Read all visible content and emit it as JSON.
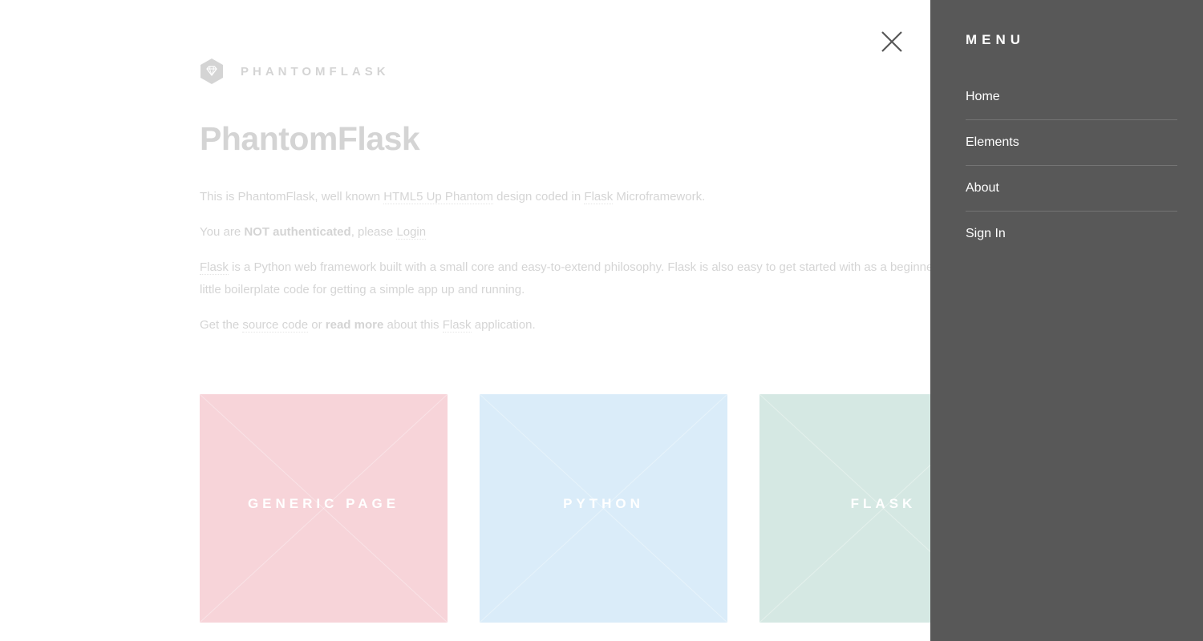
{
  "site": {
    "logo_title": "PHANTOMFLASK",
    "page_title": "PhantomFlask"
  },
  "intro": {
    "p1": {
      "t1": "This is PhantomFlask, well known ",
      "link1": "HTML5 Up Phantom",
      "t2": " design coded in ",
      "link2": "Flask",
      "t3": " Microframework."
    },
    "p2": {
      "t1": "You are ",
      "strong": "NOT authenticated",
      "t2": ", please ",
      "link": "Login"
    },
    "p3": {
      "link": "Flask",
      "t1": " is a Python web framework built with a small core and easy-to-extend philosophy. Flask is also easy to get started with as a beginner beca",
      "line2": "little boilerplate code for getting a simple app up and running."
    },
    "p4": {
      "t1": "Get the ",
      "link1": "source code",
      "t2": " or ",
      "strong": "read more",
      "t3": " about this ",
      "link2": "Flask",
      "t4": " application."
    }
  },
  "tiles": [
    {
      "label": "GENERIC PAGE",
      "color": "#e0566c"
    },
    {
      "label": "PYTHON",
      "color": "#6fb8e8"
    },
    {
      "label": "FLASK",
      "color": "#5ca891"
    }
  ],
  "menu": {
    "heading": "MENU",
    "items": [
      {
        "label": "Home"
      },
      {
        "label": "Elements"
      },
      {
        "label": "About"
      },
      {
        "label": "Sign In"
      }
    ]
  },
  "colors": {
    "panel_bg": "#585858",
    "text": "#585858",
    "accent_generic": "#e0566c",
    "accent_python": "#6fb8e8",
    "accent_flask": "#5ca891"
  },
  "icons": {
    "logo": "diamond-hexagon-icon",
    "close": "close-icon"
  }
}
